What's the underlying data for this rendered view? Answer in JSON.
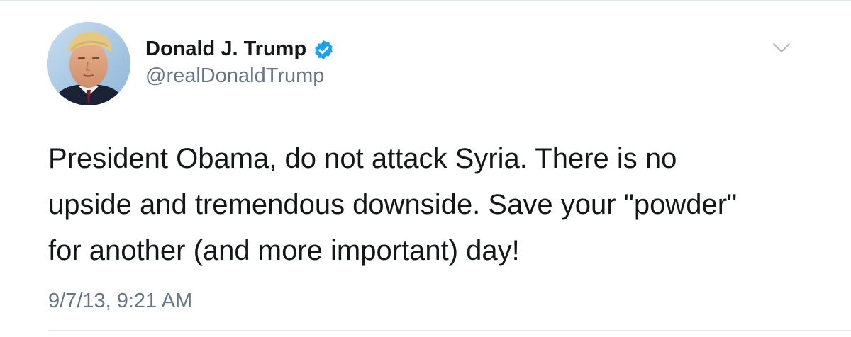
{
  "tweet": {
    "author": {
      "display_name": "Donald J. Trump",
      "handle": "@realDonaldTrump",
      "verified": true,
      "verified_icon": "verified-badge-icon",
      "avatar_icon": "profile-photo"
    },
    "text_lines": [
      "President Obama, do not attack Syria. There is no",
      "upside and tremendous downside. Save your \"powder\"",
      "for another (and more important) day!"
    ],
    "timestamp": "9/7/13, 9:21 AM",
    "menu_icon": "chevron-down-icon"
  },
  "colors": {
    "text_primary": "#14171a",
    "text_secondary": "#657786",
    "verified_blue": "#1da1f2",
    "divider": "#e6ecf0",
    "chevron": "#aab8c2"
  }
}
